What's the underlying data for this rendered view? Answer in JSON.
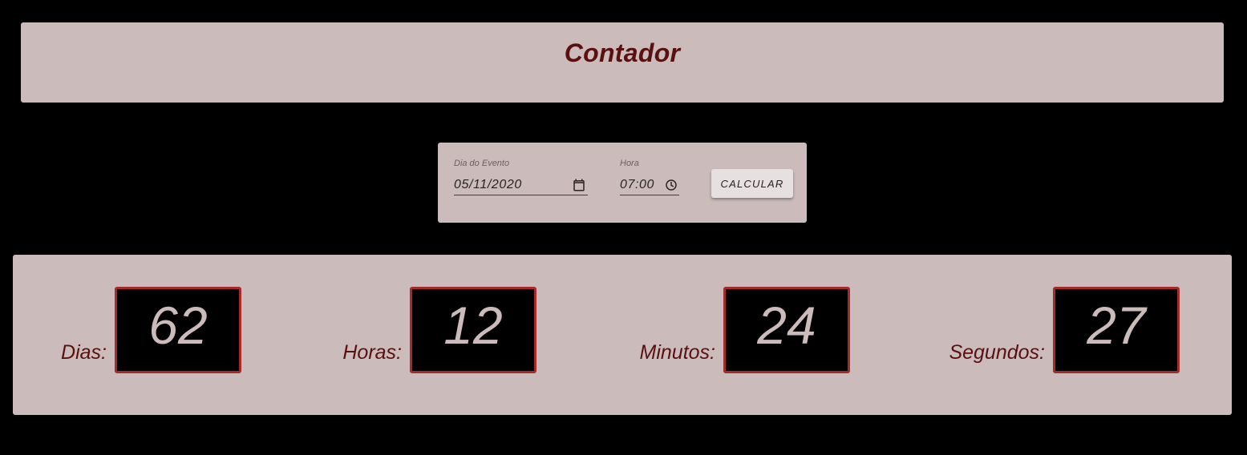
{
  "header": {
    "title": "Contador"
  },
  "form": {
    "date_label": "Dia do Evento",
    "date_value": "05/11/2020",
    "time_label": "Hora",
    "time_value": "07:00",
    "calculate_label": "CALCULAR"
  },
  "counter": {
    "units": [
      {
        "label": "Dias:",
        "value": "62"
      },
      {
        "label": "Horas:",
        "value": "12"
      },
      {
        "label": "Minutos:",
        "value": "24"
      },
      {
        "label": "Segundos:",
        "value": "27"
      }
    ]
  },
  "colors": {
    "background": "#000000",
    "panel": "#cbbbbb",
    "accent_text": "#5a1010",
    "box_border": "#a52a2a"
  },
  "icons": {
    "date_picker": "calendar-icon",
    "time_picker": "clock-icon"
  }
}
